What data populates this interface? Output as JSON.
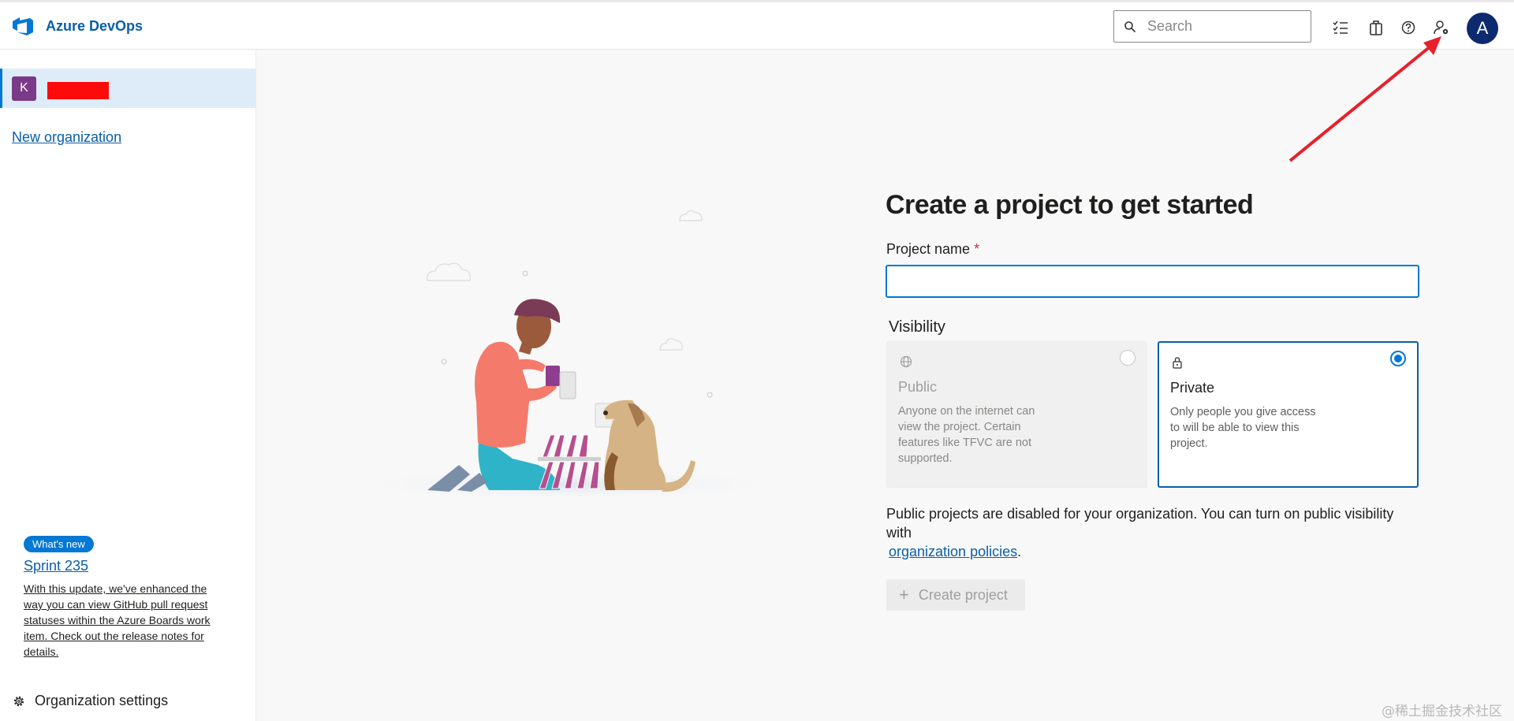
{
  "header": {
    "brand": "Azure DevOps",
    "search_placeholder": "Search",
    "avatar_initial": "A"
  },
  "sidebar": {
    "org_initial": "K",
    "new_org_label": "New organization",
    "whats_new_badge": "What's new",
    "whats_new_title": "Sprint 235",
    "whats_new_desc": "With this update, we've enhanced the way you can view GitHub pull request statuses within the Azure Boards work item. Check out the release notes for details.",
    "org_settings_label": "Organization settings"
  },
  "main": {
    "title": "Create a project to get started",
    "project_name_label": "Project name",
    "required_marker": "*",
    "visibility_label": "Visibility",
    "visibility_options": [
      {
        "title": "Public",
        "description": "Anyone on the internet can view the project. Certain features like TFVC are not supported.",
        "selected": false
      },
      {
        "title": "Private",
        "description": "Only people you give access to will be able to view this project.",
        "selected": true
      }
    ],
    "public_note": "Public projects are disabled for your organization. You can turn on public visibility with",
    "public_note_link": "organization policies",
    "public_note_end": ".",
    "create_button": "Create project",
    "create_button_icon": "+"
  },
  "watermark": "@稀土掘金技术社区",
  "colors": {
    "accent": "#0078d4",
    "brand_text": "#0a5ea8",
    "avatar_bg": "#0d2a6e",
    "org_badge_bg": "#7b3a87",
    "annotation_arrow": "#e8202a"
  }
}
